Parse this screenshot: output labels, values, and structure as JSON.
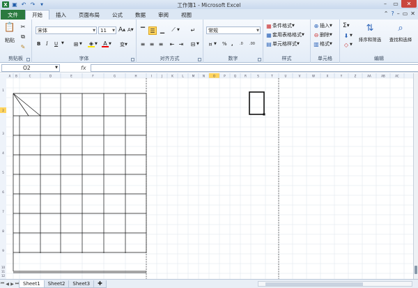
{
  "window": {
    "title": "工作簿1 - Microsoft Excel"
  },
  "tabs": [
    {
      "label": "文件",
      "kind": "file"
    },
    {
      "label": "开始",
      "kind": "active"
    },
    {
      "label": "插入"
    },
    {
      "label": "页面布局"
    },
    {
      "label": "公式"
    },
    {
      "label": "数据"
    },
    {
      "label": "审阅"
    },
    {
      "label": "视图"
    }
  ],
  "ribbon": {
    "clipboard": {
      "label": "剪贴板",
      "paste": "粘贴"
    },
    "font": {
      "label": "字体",
      "name": "宋体",
      "size": "11",
      "bold": "B",
      "italic": "I",
      "underline": "U",
      "grow": "A",
      "shrink": "A",
      "phonetic": "变"
    },
    "alignment": {
      "label": "对齐方式"
    },
    "number": {
      "label": "数字",
      "format": "常规",
      "percent": "%",
      "comma": ",",
      "dec_inc": ".0",
      "dec_dec": ".00"
    },
    "styles": {
      "label": "样式",
      "conditional": "条件格式",
      "table": "套用表格格式",
      "cell": "单元格样式"
    },
    "cells": {
      "label": "单元格",
      "insert": "插入",
      "delete": "删除",
      "format": "格式"
    },
    "editing": {
      "label": "编辑",
      "sort": "排序和筛选",
      "find": "查找和选择",
      "sum": "Σ"
    }
  },
  "formula_bar": {
    "name_box": "O2",
    "fx": "fx",
    "value": ""
  },
  "sheet": {
    "columns": [
      "A",
      "B",
      "C",
      "D",
      "E",
      "F",
      "G",
      "H",
      "I",
      "J",
      "K",
      "L",
      "M",
      "N",
      "O",
      "P",
      "Q",
      "R",
      "S",
      "T",
      "U",
      "V",
      "W",
      "X",
      "Y",
      "Z",
      "AA",
      "AB",
      "AC"
    ],
    "selected_column": "O",
    "row_numbers": [
      "1",
      "2",
      "3",
      "4",
      "5",
      "6",
      "7",
      "8",
      "9",
      "10",
      "11",
      "12"
    ],
    "selected_row": "2"
  },
  "sheet_tabs": [
    {
      "label": "Sheet1",
      "active": true
    },
    {
      "label": "Sheet2"
    },
    {
      "label": "Sheet3"
    }
  ],
  "colors": {
    "file_tab": "#2b7a3f",
    "selection": "#ffd45e",
    "accent": "#1e5aa8"
  }
}
